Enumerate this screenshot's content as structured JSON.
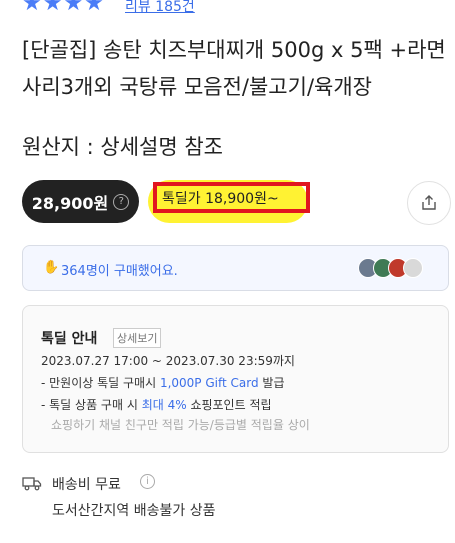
{
  "rating": {
    "stars": "★★★★",
    "review_link": "리뷰 185건"
  },
  "product": {
    "title": "[단골집] 송탄 치즈부대찌개 500g x 5팩 +라면사리3개외 국탕류 모음전/불고기/육개장",
    "origin": "원산지 : 상세설명 참조"
  },
  "price": {
    "regular": "28,900원",
    "help_icon": "?",
    "deal": "톡딜가 18,900원~"
  },
  "buyers": {
    "text": "364명이 구매했어요.",
    "thumb_colors": [
      "#6b7a8f",
      "#3f7a55",
      "#c0392b",
      "#d9d9d9"
    ]
  },
  "deal_info": {
    "title": "톡딜 안내",
    "detail_button": "상세보기",
    "period": "2023.07.27 17:00 ~ 2023.07.30 23:59까지",
    "line1_prefix": "- 만원이상 톡딜 구매시 ",
    "line1_highlight": "1,000P Gift Card",
    "line1_suffix": " 발급",
    "line2_prefix": "- 톡딜 상품 구매 시 ",
    "line2_highlight": "최대 4%",
    "line2_suffix": " 쇼핑포인트 적립",
    "note": "쇼핑하기 채널 친구만 적립 가능/등급별 적립율 상이"
  },
  "shipping": {
    "label": "배송비 무료",
    "info_icon": "i",
    "note": "도서산간지역 배송불가 상품"
  },
  "colors": {
    "accent_blue": "#3b6ee8",
    "highlight_yellow": "#fff233",
    "annotation_red": "#e1151f",
    "dark_pill": "#222222"
  }
}
